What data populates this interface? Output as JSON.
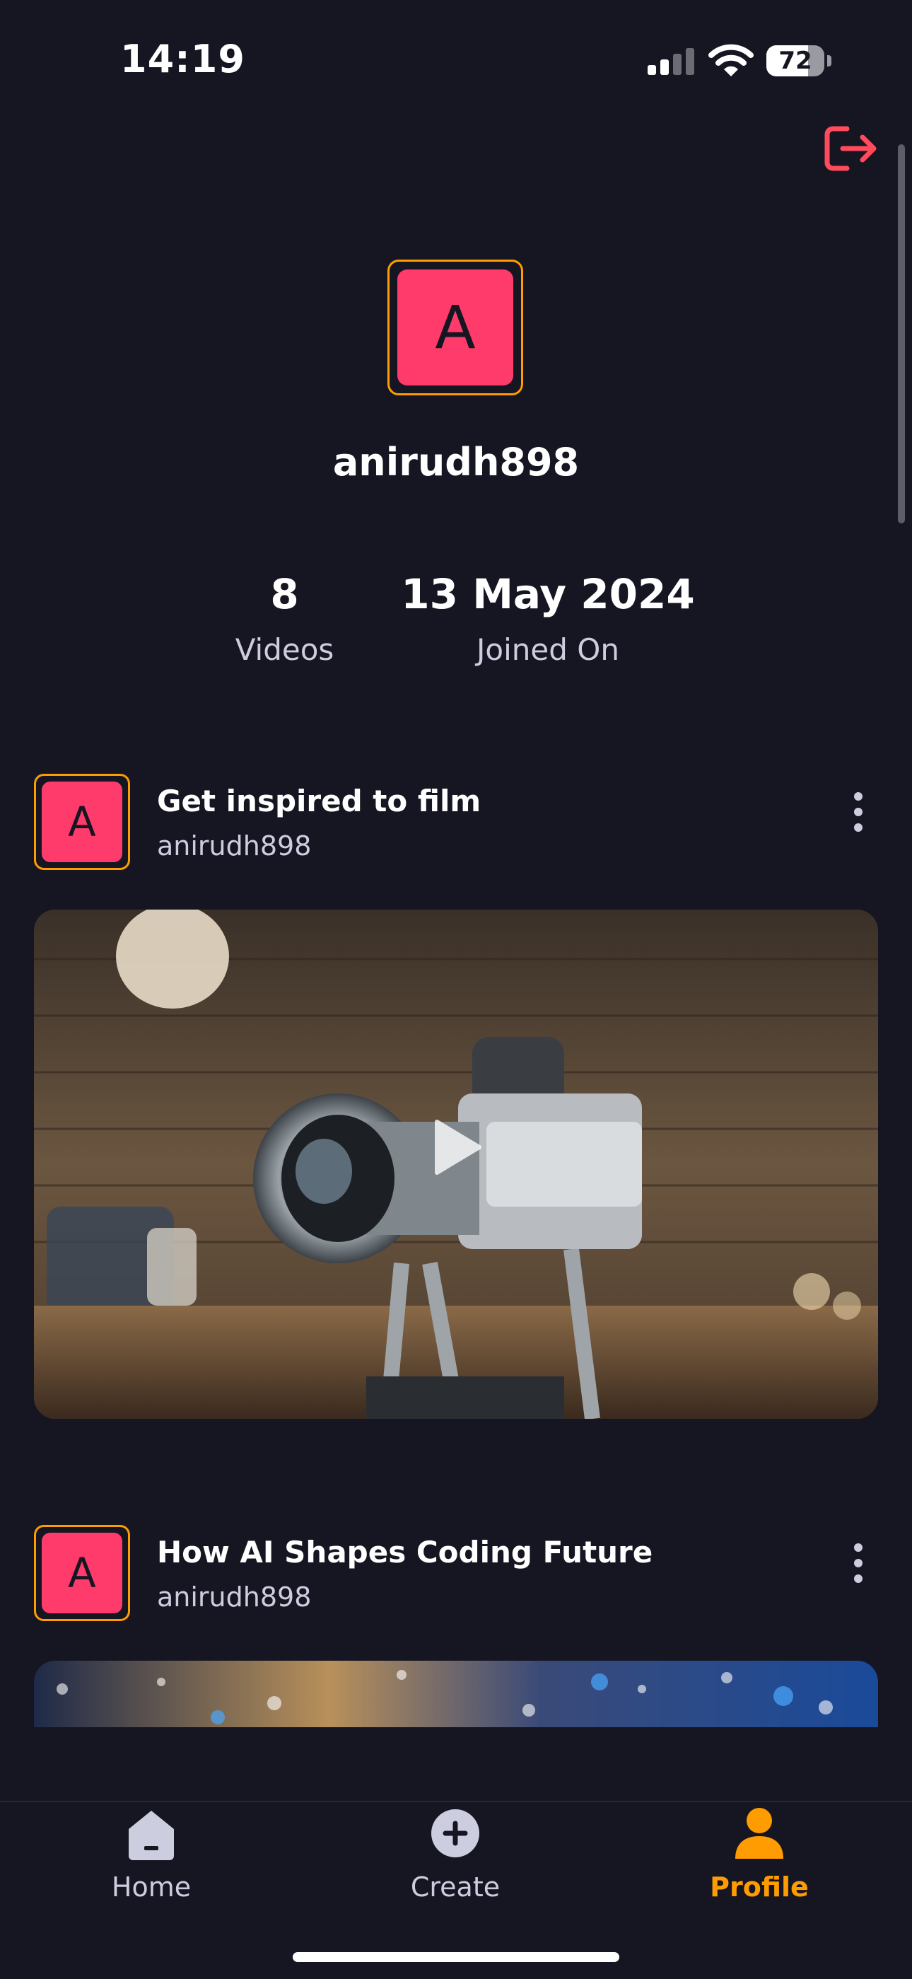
{
  "status_bar": {
    "time": "14:19",
    "battery_level": 72,
    "battery_text": "72"
  },
  "header": {
    "logout_icon": "logout-icon",
    "logout_color": "#ff4b5c"
  },
  "profile": {
    "avatar_letter": "A",
    "username": "anirudh898",
    "stats": [
      {
        "value": "8",
        "label": "Videos"
      },
      {
        "value": "13 May 2024",
        "label": "Joined On"
      }
    ]
  },
  "posts": [
    {
      "avatar_letter": "A",
      "title": "Get inspired to film",
      "author": "anirudh898",
      "thumbnail": "camera-on-tripod-photo"
    },
    {
      "avatar_letter": "A",
      "title": "How AI Shapes Coding Future",
      "author": "anirudh898",
      "thumbnail": "bokeh-lights-photo"
    }
  ],
  "tabs": [
    {
      "label": "Home",
      "icon": "home-icon",
      "active": false
    },
    {
      "label": "Create",
      "icon": "plus-circle-icon",
      "active": false
    },
    {
      "label": "Profile",
      "icon": "profile-icon",
      "active": true
    }
  ],
  "colors": {
    "background": "#161622",
    "accent": "#ff9c01",
    "avatar": "#ff3b6b",
    "secondary_text": "#cdcde0"
  }
}
